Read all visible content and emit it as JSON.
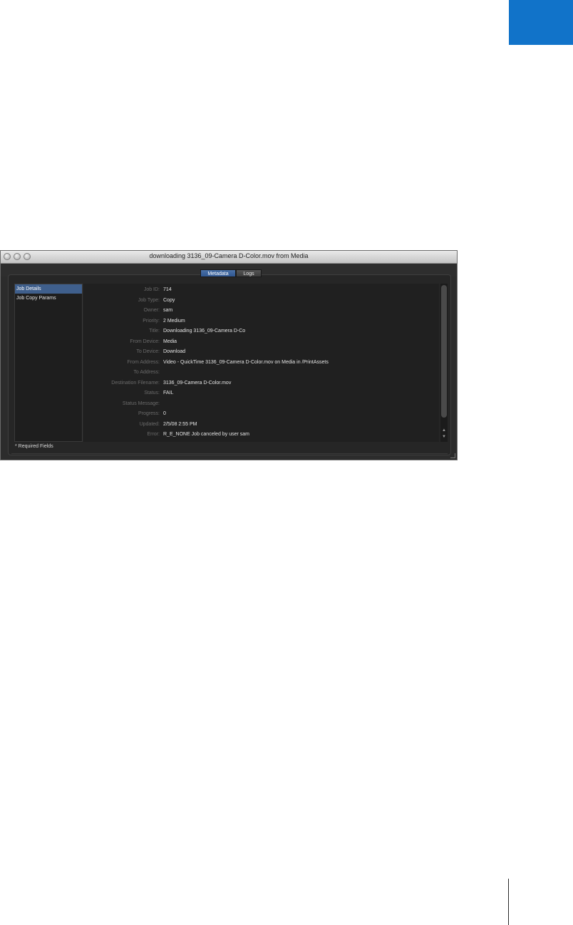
{
  "window": {
    "title": "downloading 3136_09-Camera D-Color.mov from Media"
  },
  "tabs": [
    {
      "label": "Metadata",
      "active": true
    },
    {
      "label": "Logs",
      "active": false
    }
  ],
  "sidebar": {
    "items": [
      {
        "label": "Job Details",
        "selected": true
      },
      {
        "label": "Job Copy Params",
        "selected": false
      }
    ]
  },
  "fields": [
    {
      "label": "Job ID:",
      "value": "714"
    },
    {
      "label": "Job Type:",
      "value": "Copy"
    },
    {
      "label": "Owner:",
      "value": "sam"
    },
    {
      "label": "Priority:",
      "value": "2 Medium"
    },
    {
      "label": "Title:",
      "value": "Downloading 3136_09-Camera D-Co"
    },
    {
      "label": "From Device:",
      "value": "Media"
    },
    {
      "label": "To Device:",
      "value": "Download"
    },
    {
      "label": "From Address:",
      "value": "Video - QuickTime 3136_09-Camera D-Color.mov on Media in /PrintAssets"
    },
    {
      "label": "To Address:",
      "value": ""
    },
    {
      "label": "Destination Filename:",
      "value": "3136_09-Camera D-Color.mov"
    },
    {
      "label": "Status:",
      "value": "FAIL"
    },
    {
      "label": "Status Message:",
      "value": ""
    },
    {
      "label": "Progress:",
      "value": "0"
    },
    {
      "label": "Updated:",
      "value": "2/5/08 2:55 PM"
    },
    {
      "label": "Error:",
      "value": "R_E_NONE Job canceled by user sam"
    }
  ],
  "footer": {
    "note": "* Required Fields"
  },
  "colors": {
    "accent_tab": "#1173c9",
    "selection": "#3f5f8c",
    "window_bg": "#2c2c2c"
  }
}
